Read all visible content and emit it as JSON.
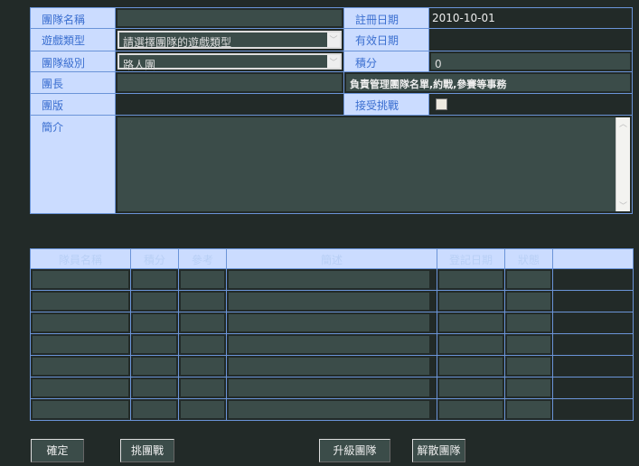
{
  "form": {
    "team_name_label": "團隊名稱",
    "team_name_value": "",
    "game_type_label": "遊戲類型",
    "game_type_value": "請選擇團隊的遊戲類型",
    "team_level_label": "團隊級別",
    "team_level_value": "路人團",
    "leader_label": "團長",
    "leader_value": "",
    "moderator_label": "團版",
    "moderator_value": "",
    "intro_label": "簡介",
    "intro_value": "",
    "reg_date_label": "註冊日期",
    "reg_date_value": "2010-10-01",
    "valid_date_label": "有效日期",
    "valid_date_value": "",
    "points_label": "積分",
    "points_value": "0",
    "leader_desc": "負責管理團隊名單,約戰,參賽等事務",
    "accept_challenge_label": "接受挑戰",
    "accept_challenge_checked": false
  },
  "members_table": {
    "headers": [
      "隊員名稱",
      "積分",
      "參考",
      "簡述",
      "登記日期",
      "狀態",
      ""
    ],
    "row_count": 7
  },
  "buttons": {
    "confirm": "確定",
    "challenge": "挑團戰",
    "upgrade": "升級團隊",
    "disband": "解散團隊"
  }
}
